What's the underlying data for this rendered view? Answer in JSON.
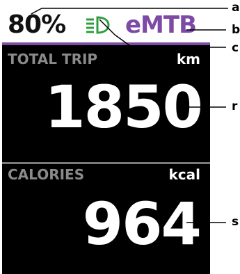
{
  "status": {
    "battery": "80%",
    "light_icon": "headlight-icon",
    "mode": "eMTB"
  },
  "trip": {
    "label": "TOTAL TRIP",
    "unit": "km",
    "value": "1850"
  },
  "calories": {
    "label": "CALORIES",
    "unit": "kcal",
    "value": "964"
  },
  "callouts": [
    "a",
    "b",
    "c",
    "r",
    "s"
  ],
  "colors": {
    "mode_accent": "#7d4aa6",
    "light_icon": "#2e9e3e",
    "label_gray": "#8a8a8a",
    "screen_bg": "#000000"
  }
}
